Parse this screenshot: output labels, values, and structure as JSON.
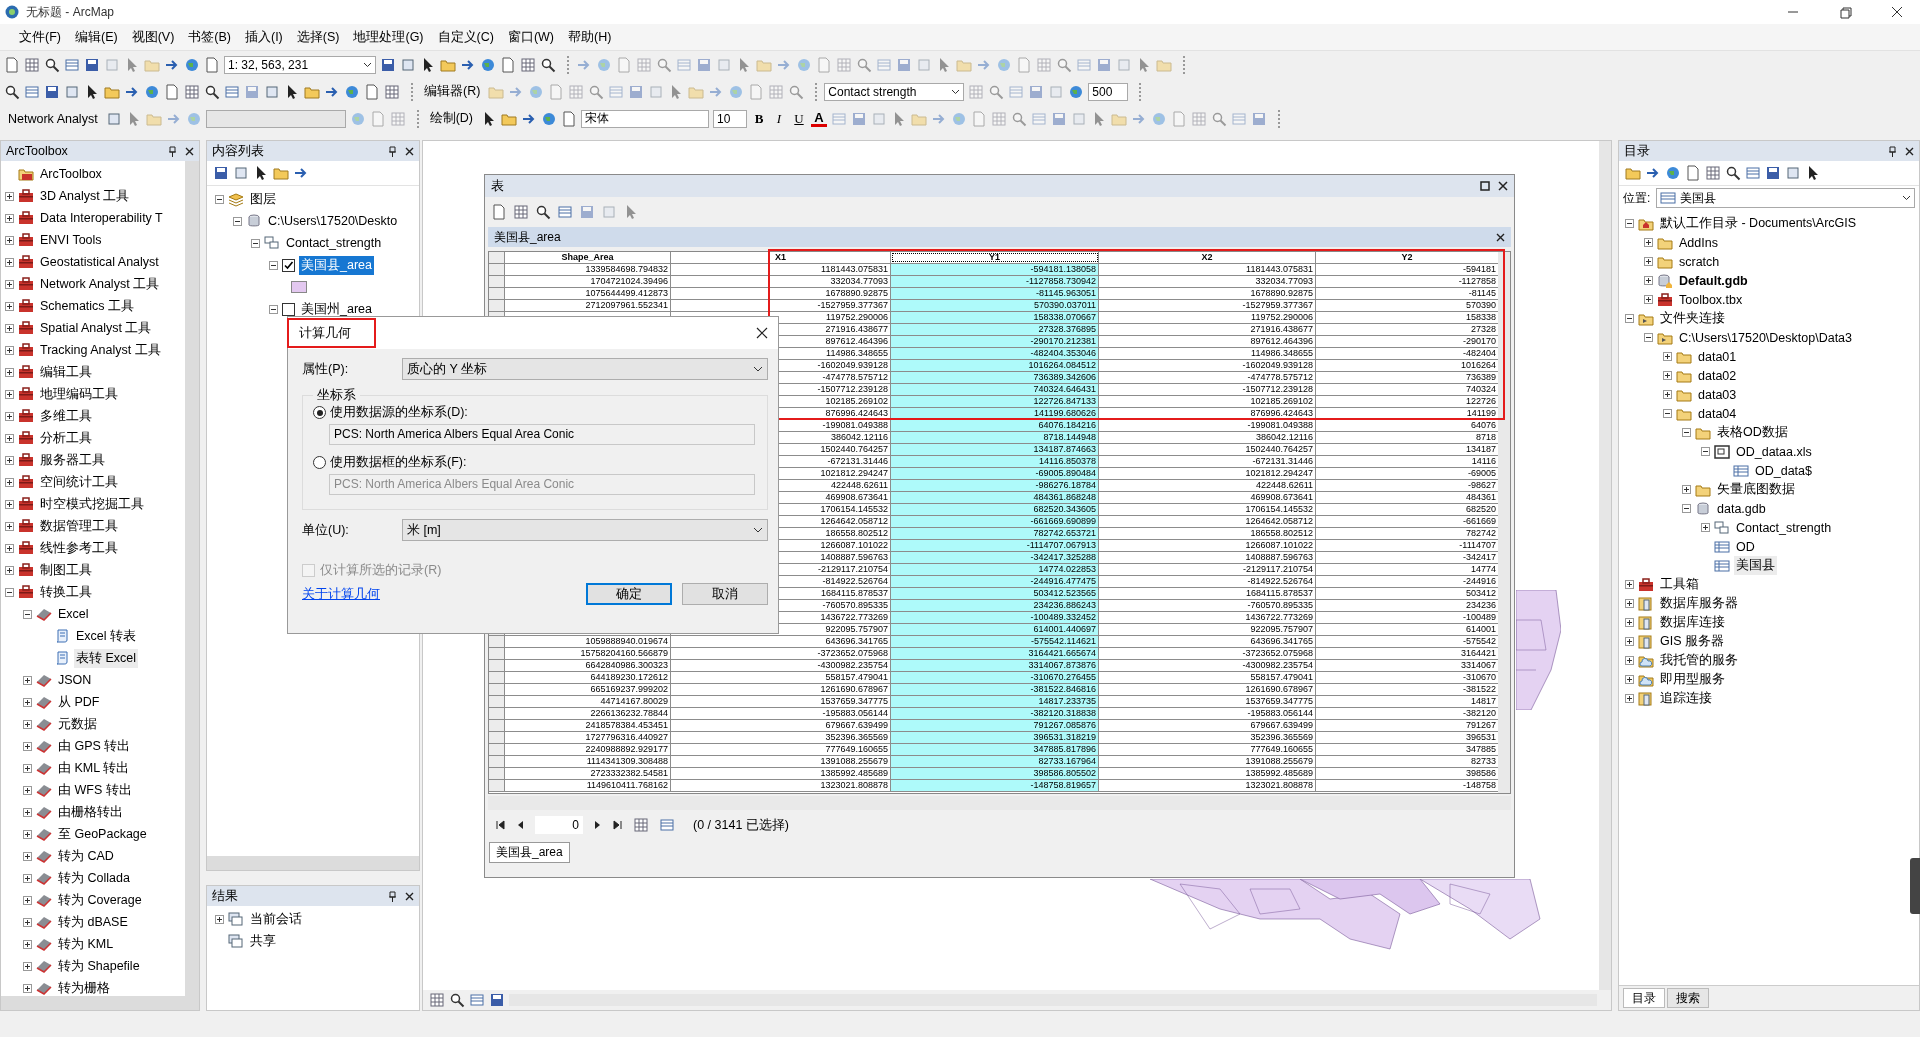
{
  "window": {
    "title": "无标题 - ArcMap"
  },
  "menu": [
    "文件(F)",
    "编辑(E)",
    "视图(V)",
    "书签(B)",
    "插入(I)",
    "选择(S)",
    "地理处理(G)",
    "自定义(C)",
    "窗口(W)",
    "帮助(H)"
  ],
  "toolbars": {
    "scale": "1: 32, 563, 231",
    "editor_menu": "编辑器(R)",
    "layer": "Contact strength",
    "zoom_value": "500",
    "network_menu": "Network Analyst",
    "drawing_menu": "绘制(D)",
    "font": "宋体",
    "font_size": "10",
    "bold": "B",
    "italic": "I",
    "underline": "U",
    "font_color": "A"
  },
  "toolbox": {
    "title": "ArcToolbox",
    "items": [
      {
        "label": "ArcToolbox",
        "kind": "root"
      },
      {
        "label": "3D Analyst 工具",
        "kind": "toolbox",
        "expanded": false
      },
      {
        "label": "Data Interoperability T",
        "kind": "toolbox",
        "expanded": false
      },
      {
        "label": "ENVI Tools",
        "kind": "toolbox",
        "expanded": false
      },
      {
        "label": "Geostatistical Analyst",
        "kind": "toolbox",
        "expanded": false
      },
      {
        "label": "Network Analyst 工具",
        "kind": "toolbox",
        "expanded": false
      },
      {
        "label": "Schematics 工具",
        "kind": "toolbox",
        "expanded": false
      },
      {
        "label": "Spatial Analyst 工具",
        "kind": "toolbox",
        "expanded": false
      },
      {
        "label": "Tracking Analyst 工具",
        "kind": "toolbox",
        "expanded": false
      },
      {
        "label": "编辑工具",
        "kind": "toolbox",
        "expanded": false
      },
      {
        "label": "地理编码工具",
        "kind": "toolbox",
        "expanded": false
      },
      {
        "label": "多维工具",
        "kind": "toolbox",
        "expanded": false
      },
      {
        "label": "分析工具",
        "kind": "toolbox",
        "expanded": false
      },
      {
        "label": "服务器工具",
        "kind": "toolbox",
        "expanded": false
      },
      {
        "label": "空间统计工具",
        "kind": "toolbox",
        "expanded": false
      },
      {
        "label": "时空模式挖掘工具",
        "kind": "toolbox",
        "expanded": false
      },
      {
        "label": "数据管理工具",
        "kind": "toolbox",
        "expanded": false
      },
      {
        "label": "线性参考工具",
        "kind": "toolbox",
        "expanded": false
      },
      {
        "label": "制图工具",
        "kind": "toolbox",
        "expanded": false
      },
      {
        "label": "转换工具",
        "kind": "toolbox",
        "expanded": true,
        "children": [
          {
            "label": "Excel",
            "kind": "toolset",
            "expanded": true,
            "children": [
              {
                "label": "Excel 转表",
                "kind": "tool",
                "selected": false
              },
              {
                "label": "表转 Excel",
                "kind": "tool",
                "selected": true
              }
            ]
          },
          {
            "label": "JSON",
            "kind": "toolset",
            "expanded": false
          },
          {
            "label": "从 PDF",
            "kind": "toolset",
            "expanded": false
          },
          {
            "label": "元数据",
            "kind": "toolset",
            "expanded": false
          },
          {
            "label": "由 GPS 转出",
            "kind": "toolset",
            "expanded": false
          },
          {
            "label": "由 KML 转出",
            "kind": "toolset",
            "expanded": false
          },
          {
            "label": "由 WFS 转出",
            "kind": "toolset",
            "expanded": false
          },
          {
            "label": "由栅格转出",
            "kind": "toolset",
            "expanded": false
          },
          {
            "label": "至 GeoPackage",
            "kind": "toolset",
            "expanded": false
          },
          {
            "label": "转为 CAD",
            "kind": "toolset",
            "expanded": false
          },
          {
            "label": "转为 Collada",
            "kind": "toolset",
            "expanded": false
          },
          {
            "label": "转为 Coverage",
            "kind": "toolset",
            "expanded": false
          },
          {
            "label": "转为 dBASE",
            "kind": "toolset",
            "expanded": false
          },
          {
            "label": "转为 KML",
            "kind": "toolset",
            "expanded": false
          },
          {
            "label": "转为 Shapefile",
            "kind": "toolset",
            "expanded": false
          },
          {
            "label": "转为栅格",
            "kind": "toolset",
            "expanded": false
          }
        ]
      }
    ]
  },
  "contents": {
    "title": "内容列表",
    "items": [
      {
        "label": "图层",
        "kind": "layers",
        "expanded": true,
        "children": [
          {
            "label": "C:\\Users\\17520\\Deskto",
            "kind": "database",
            "expanded": true,
            "children": [
              {
                "label": "Contact_strength",
                "kind": "dataset",
                "expanded": true,
                "children": [
                  {
                    "label": "美国县_area",
                    "kind": "layer",
                    "expanded": true,
                    "checked": true,
                    "selected": true,
                    "color": "#e3c8f0"
                  },
                  {
                    "label": "美国州_area",
                    "kind": "layer",
                    "expanded": true,
                    "checked": false,
                    "selected": false
                  }
                ]
              }
            ]
          }
        ]
      }
    ]
  },
  "results": {
    "title": "结果",
    "items": [
      {
        "label": "当前会话",
        "expanded": false
      },
      {
        "label": "共享"
      }
    ]
  },
  "catalog": {
    "title": "目录",
    "location_label": "位置:",
    "location": "美国县",
    "items": [
      {
        "label": "默认工作目录 - Documents\\ArcGIS",
        "kind": "workspace",
        "expanded": true,
        "children": [
          {
            "label": "AddIns",
            "kind": "folder",
            "expanded": false
          },
          {
            "label": "scratch",
            "kind": "folder",
            "expanded": false
          },
          {
            "label": "Default.gdb",
            "kind": "home_gdb",
            "expanded": false
          },
          {
            "label": "Toolbox.tbx",
            "kind": "toolbox",
            "expanded": false
          }
        ]
      },
      {
        "label": "文件夹连接",
        "kind": "connections",
        "expanded": true,
        "children": [
          {
            "label": "C:\\Users\\17520\\Desktop\\Data3",
            "kind": "folder_connection",
            "expanded": true,
            "children": [
              {
                "label": "data01",
                "kind": "folder",
                "expanded": false
              },
              {
                "label": "data02",
                "kind": "folder",
                "expanded": false
              },
              {
                "label": "data03",
                "kind": "folder",
                "expanded": false
              },
              {
                "label": "data04",
                "kind": "folder",
                "expanded": true,
                "children": [
                  {
                    "label": "表格OD数据",
                    "kind": "folder",
                    "expanded": true,
                    "children": [
                      {
                        "label": "OD_dataa.xls",
                        "kind": "excel",
                        "expanded": true,
                        "children": [
                          {
                            "label": "OD_data$",
                            "kind": "table",
                            "selected": false
                          }
                        ]
                      }
                    ]
                  },
                  {
                    "label": "矢量底图数据",
                    "kind": "folder",
                    "expanded": false
                  },
                  {
                    "label": "data.gdb",
                    "kind": "gdb",
                    "expanded": true,
                    "children": [
                      {
                        "label": "Contact_strength",
                        "kind": "dataset",
                        "expanded": false
                      },
                      {
                        "label": "OD",
                        "kind": "table",
                        "selected": false
                      },
                      {
                        "label": "美国县",
                        "kind": "table",
                        "selected": true
                      }
                    ]
                  }
                ]
              }
            ]
          }
        ]
      },
      {
        "label": "工具箱",
        "kind": "toolbox",
        "expanded": false
      },
      {
        "label": "数据库服务器",
        "kind": "server",
        "expanded": false
      },
      {
        "label": "数据库连接",
        "kind": "server",
        "expanded": false
      },
      {
        "label": "GIS 服务器",
        "kind": "server",
        "expanded": false
      },
      {
        "label": "我托管的服务",
        "kind": "cloud",
        "expanded": false
      },
      {
        "label": "即用型服务",
        "kind": "cloud",
        "expanded": false
      },
      {
        "label": "追踪连接",
        "kind": "server",
        "expanded": false
      }
    ],
    "tabs": [
      {
        "label": "目录",
        "selected": true
      },
      {
        "label": "搜索",
        "selected": false
      }
    ]
  },
  "table": {
    "title": "表",
    "tab": "美国县_area",
    "columns": [
      {
        "name": "Shape_Area",
        "selected": false
      },
      {
        "name": "X1",
        "selected": false
      },
      {
        "name": "Y1",
        "selected": true
      },
      {
        "name": "X2",
        "selected": false
      },
      {
        "name": "Y2",
        "selected": false
      }
    ],
    "rows": [
      [
        "1339584698.794832",
        "1181443.075831",
        "-594181.138058",
        "1181443.075831",
        "-594181"
      ],
      [
        "1704721024.39496",
        "332034.77093",
        "-1127858.730942",
        "332034.77093",
        "-1127858"
      ],
      [
        "1075644499.412873",
        "1678890.92875",
        "-81145.963051",
        "1678890.92875",
        "-81145"
      ],
      [
        "2712097961.552341",
        "-1527959.377367",
        "570390.037011",
        "-1527959.377367",
        "570390"
      ],
      [
        null,
        "119752.290006",
        "158338.070667",
        "119752.290006",
        "158338"
      ],
      [
        null,
        "271916.438677",
        "27328.376895",
        "271916.438677",
        "27328"
      ],
      [
        null,
        "897612.464396",
        "-290170.212381",
        "897612.464396",
        "-290170"
      ],
      [
        null,
        "114986.348655",
        "-482404.353046",
        "114986.348655",
        "-482404"
      ],
      [
        null,
        "-1602049.939128",
        "1016264.084512",
        "-1602049.939128",
        "1016264"
      ],
      [
        null,
        "-474778.575712",
        "736389.342606",
        "-474778.575712",
        "736389"
      ],
      [
        null,
        "-1507712.239128",
        "740324.646431",
        "-1507712.239128",
        "740324"
      ],
      [
        null,
        "102185.269102",
        "122726.847133",
        "102185.269102",
        "122726"
      ],
      [
        null,
        "876996.424643",
        "141199.680626",
        "876996.424643",
        "141199"
      ],
      [
        null,
        "-199081.049388",
        "64076.184216",
        "-199081.049388",
        "64076"
      ],
      [
        null,
        "386042.12116",
        "8718.144948",
        "386042.12116",
        "8718"
      ],
      [
        null,
        "1502440.764257",
        "134187.874663",
        "1502440.764257",
        "134187"
      ],
      [
        null,
        "-672131.31446",
        "14116.850378",
        "-672131.31446",
        "14116"
      ],
      [
        null,
        "1021812.294247",
        "-69005.890484",
        "1021812.294247",
        "-69005"
      ],
      [
        null,
        "422448.62611",
        "-986276.18784",
        "422448.62611",
        "-98627"
      ],
      [
        null,
        "469908.673641",
        "484361.868248",
        "469908.673641",
        "484361"
      ],
      [
        null,
        "1706154.145532",
        "682520.343605",
        "1706154.145532",
        "682520"
      ],
      [
        null,
        "1264642.058712",
        "-661669.690899",
        "1264642.058712",
        "-661669"
      ],
      [
        null,
        "186558.802512",
        "782742.653721",
        "186558.802512",
        "782742"
      ],
      [
        null,
        "1266087.101022",
        "-1114707.067913",
        "1266087.101022",
        "-1114707"
      ],
      [
        null,
        "1408887.596763",
        "-342417.325288",
        "1408887.596763",
        "-342417"
      ],
      [
        null,
        "-2129117.210754",
        "14774.022853",
        "-2129117.210754",
        "14774"
      ],
      [
        null,
        "-814922.526764",
        "-244916.477475",
        "-814922.526764",
        "-244916"
      ],
      [
        null,
        "1684115.878537",
        "503412.523565",
        "1684115.878537",
        "503412"
      ],
      [
        null,
        "-760570.895335",
        "234236.886243",
        "-760570.895335",
        "234236"
      ],
      [
        null,
        "1436722.773269",
        "-100489.332452",
        "1436722.773269",
        "-100489"
      ],
      [
        null,
        "922095.757907",
        "614001.440697",
        "922095.757907",
        "614001"
      ],
      [
        "1059888940.019674",
        "643696.341765",
        "-575542.114621",
        "643696.341765",
        "-575542"
      ],
      [
        "15758204160.566879",
        "-3723652.075968",
        "3164421.665674",
        "-3723652.075968",
        "3164421"
      ],
      [
        "6642840986.300323",
        "-4300982.235754",
        "3314067.873876",
        "-4300982.235754",
        "3314067"
      ],
      [
        "644189230.172612",
        "558157.479041",
        "-310670.276455",
        "558157.479041",
        "-310670"
      ],
      [
        "665169237.999202",
        "1261690.678967",
        "-381522.846816",
        "1261690.678967",
        "-381522"
      ],
      [
        "44714167.80029",
        "1537659.347775",
        "14817.233735",
        "1537659.347775",
        "14817"
      ],
      [
        "2266136232.78844",
        "-195883.056144",
        "-382120.318838",
        "-195883.056144",
        "-382120"
      ],
      [
        "2418578384.453451",
        "679667.639499",
        "791267.085876",
        "679667.639499",
        "791267"
      ],
      [
        "1727796316.440927",
        "352396.365569",
        "396531.318219",
        "352396.365569",
        "396531"
      ],
      [
        "2240988892.929177",
        "777649.160655",
        "347885.817896",
        "777649.160655",
        "347885"
      ],
      [
        "1114341309.308488",
        "1391088.255679",
        "82733.167964",
        "1391088.255679",
        "82733"
      ],
      [
        "2723332382.54581",
        "1385992.485689",
        "398586.805502",
        "1385992.485689",
        "398586"
      ],
      [
        "1149610411.768162",
        "1323021.808878",
        "-148758.819657",
        "1323021.808878",
        "-148758"
      ]
    ],
    "record": "0",
    "selection": "(0 / 3141 已选择)",
    "bottom_tab": "美国县_area"
  },
  "dialog": {
    "title": "计算几何",
    "property_label": "属性(P):",
    "property": "质心的 Y 坐标",
    "group": "坐标系",
    "options": [
      {
        "label": "使用数据源的坐标系(D):",
        "value": "PCS: North America Albers Equal Area Conic",
        "selected": true
      },
      {
        "label": "使用数据框的坐标系(F):",
        "value": "PCS: North America Albers Equal Area Conic",
        "selected": false
      }
    ],
    "unit_label": "单位(U):",
    "unit": "米 [m]",
    "checkbox": {
      "label": "仅计算所选的记录(R)",
      "checked": false,
      "disabled": true
    },
    "link": "关于计算几何",
    "buttons": [
      {
        "label": "确定",
        "default": true
      },
      {
        "label": "取消",
        "default": false
      }
    ]
  }
}
